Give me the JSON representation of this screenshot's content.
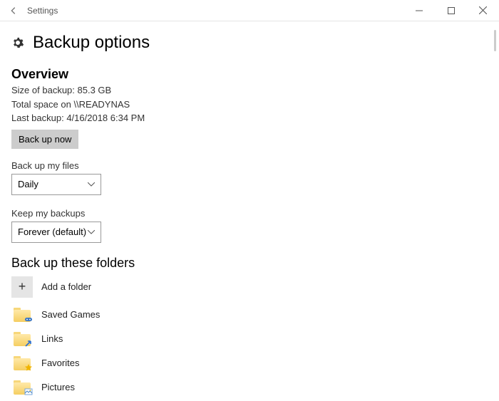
{
  "titlebar": {
    "title": "Settings"
  },
  "page": {
    "title": "Backup options"
  },
  "overview": {
    "heading": "Overview",
    "size_line": "Size of backup: 85.3 GB",
    "space_line": "Total space on \\\\READYNAS",
    "last_backup_line": "Last backup: 4/16/2018 6:34 PM",
    "backup_now_label": "Back up now"
  },
  "backup_files": {
    "label": "Back up my files",
    "value": "Daily"
  },
  "keep_backups": {
    "label": "Keep my backups",
    "value": "Forever (default)"
  },
  "folders": {
    "heading": "Back up these folders",
    "add_label": "Add a folder",
    "items": [
      {
        "label": "Saved Games",
        "icon": "controller"
      },
      {
        "label": "Links",
        "icon": "link"
      },
      {
        "label": "Favorites",
        "icon": "star"
      },
      {
        "label": "Pictures",
        "icon": "picture"
      }
    ]
  }
}
